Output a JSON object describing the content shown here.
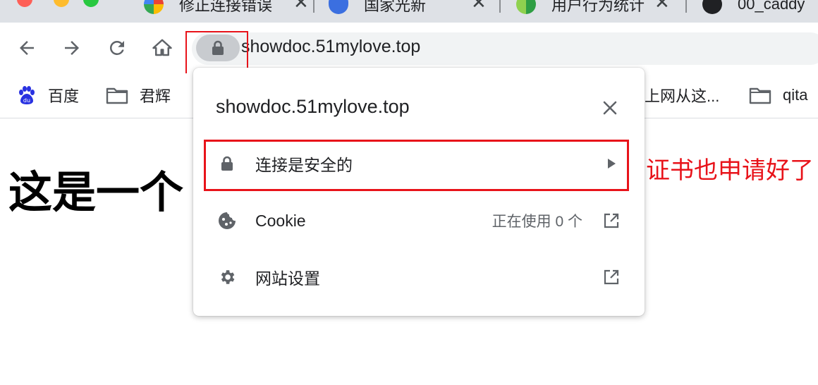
{
  "tabs": [
    {
      "title": "修正连接错误"
    },
    {
      "title": "国家光新"
    },
    {
      "title": "用户行为统计"
    },
    {
      "title": "00_caddy"
    }
  ],
  "toolbar": {
    "url": "showdoc.51mylove.top",
    "icons": [
      "back-arrow-icon",
      "forward-arrow-icon",
      "reload-icon",
      "home-icon",
      "lock-icon"
    ]
  },
  "bookmarks": [
    {
      "label": "百度",
      "icon": "baidu-icon"
    },
    {
      "label": "君辉",
      "icon": "folder-icon"
    },
    {
      "label": "上网从这...",
      "icon": "folder-icon"
    },
    {
      "label": "qita",
      "icon": "folder-icon"
    }
  ],
  "page": {
    "heading": "这是一个",
    "red_text": "证书也申请好了"
  },
  "popup": {
    "title": "showdoc.51mylove.top",
    "rows": [
      {
        "label": "连接是安全的",
        "icon": "lock-icon",
        "right_icon": "chevron-right-icon"
      },
      {
        "label": "Cookie",
        "status": "正在使用 0 个",
        "icon": "cookie-icon",
        "right_icon": "open-external-icon"
      },
      {
        "label": "网站设置",
        "icon": "gear-icon",
        "right_icon": "open-external-icon"
      }
    ]
  },
  "colors": {
    "highlight": "#e8131a",
    "icon_gray": "#5f6368",
    "omnibox_bg": "#f1f3f4",
    "tabstrip_bg": "#dee1e6"
  }
}
